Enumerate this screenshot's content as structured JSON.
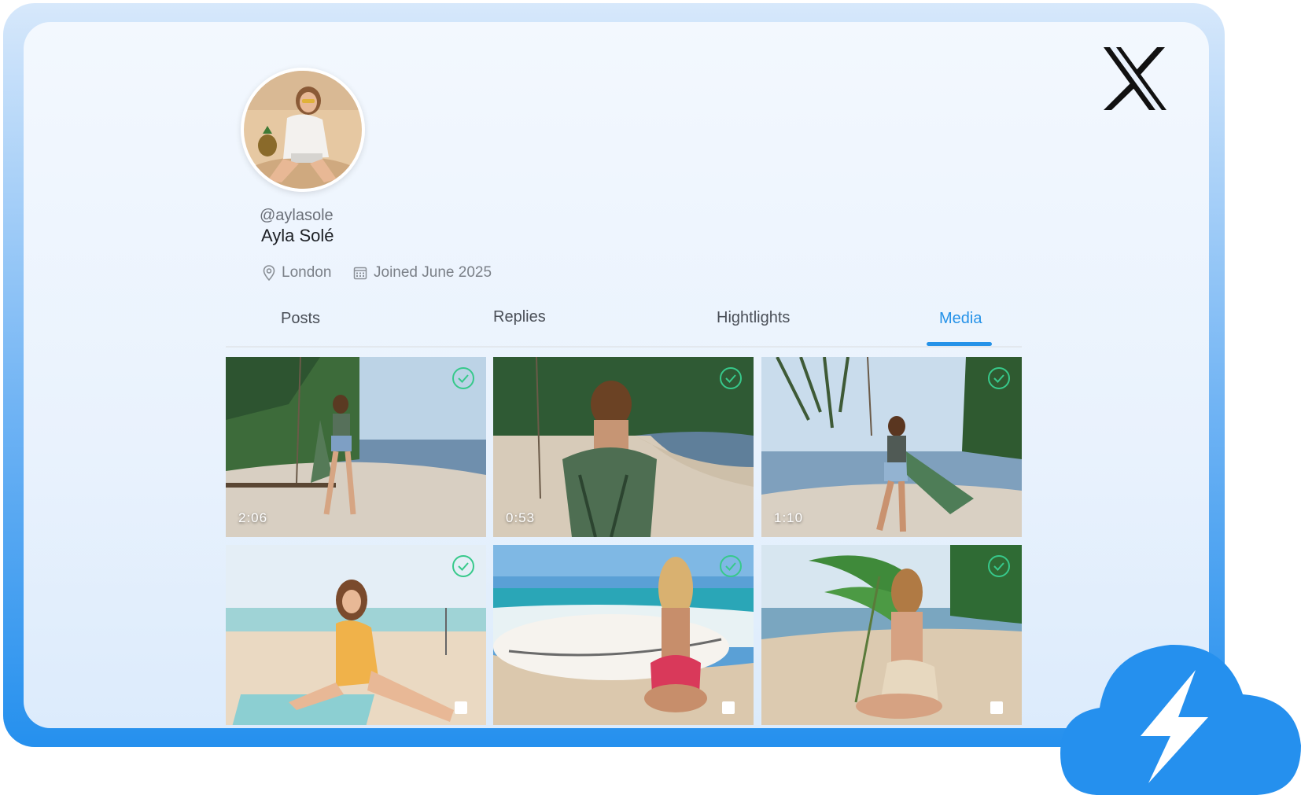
{
  "brand": {
    "logo_icon": "x-logo-icon"
  },
  "profile": {
    "handle": "@aylasole",
    "name": "Ayla Solé",
    "location": "London",
    "joined": "Joined June 2025"
  },
  "tabs": [
    {
      "label": "Posts",
      "active": false
    },
    {
      "label": "Replies",
      "active": false
    },
    {
      "label": "Hightlights",
      "active": false
    },
    {
      "label": "Media",
      "active": true
    }
  ],
  "media": [
    {
      "duration": "2:06",
      "selected": true
    },
    {
      "duration": "0:53",
      "selected": true
    },
    {
      "duration": "1:10",
      "selected": true
    },
    {
      "duration": "",
      "selected": true
    },
    {
      "duration": "",
      "selected": true
    },
    {
      "duration": "",
      "selected": true
    }
  ],
  "colors": {
    "accent": "#2592e8",
    "check": "#37c98b"
  },
  "badge": {
    "icon": "cloud-lightning-icon"
  }
}
